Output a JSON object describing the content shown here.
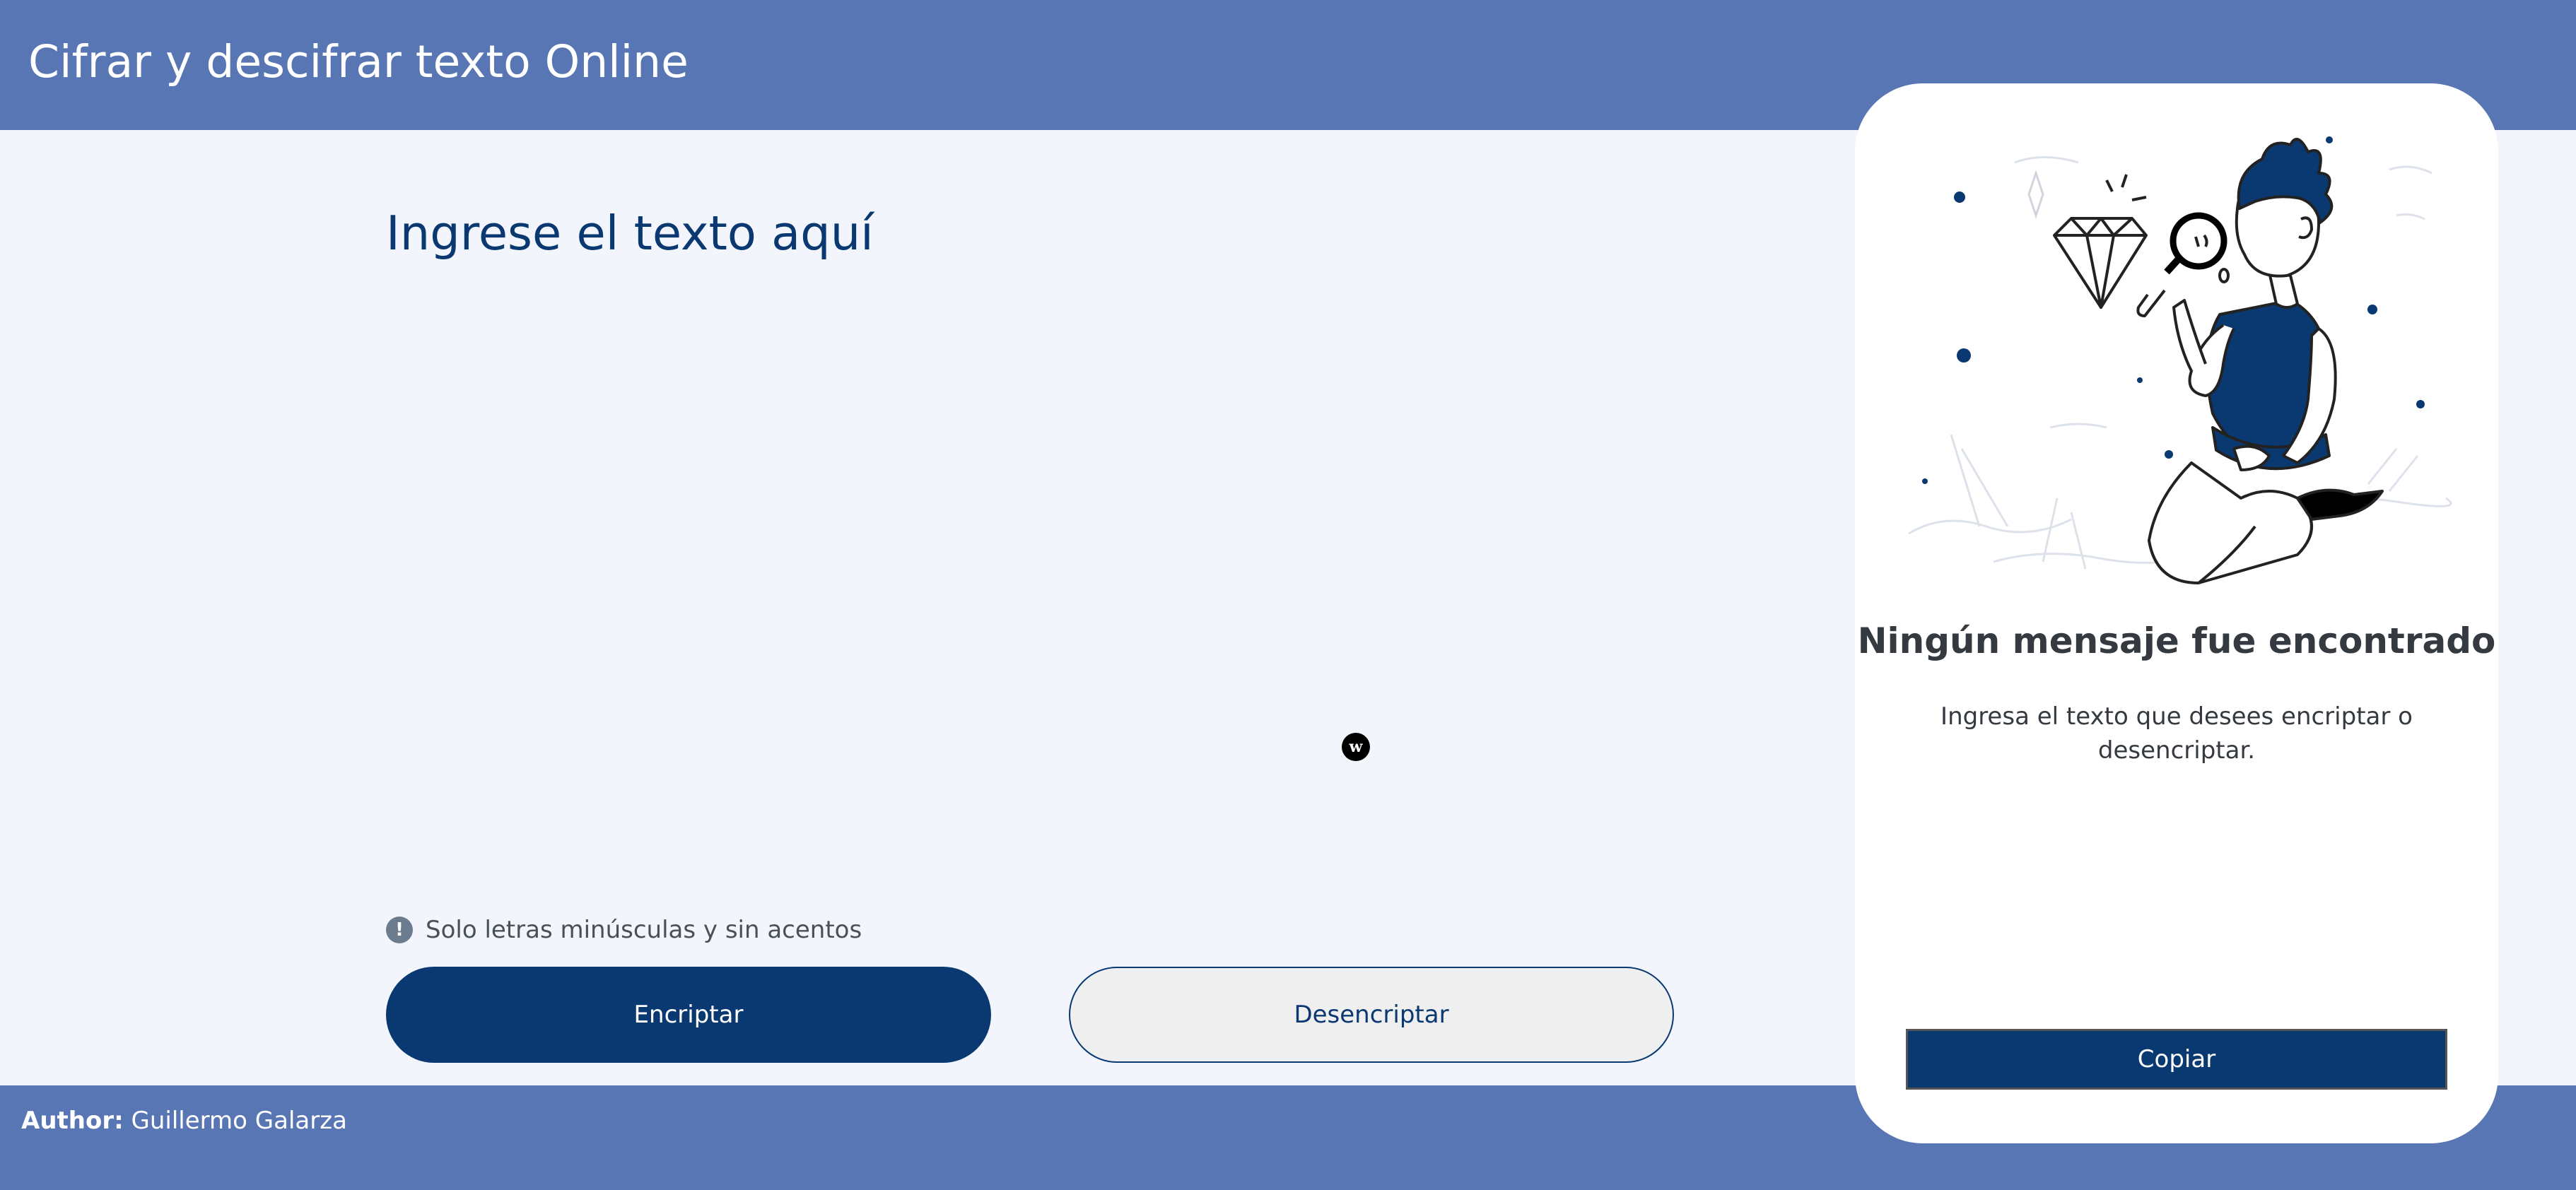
{
  "header": {
    "title": "Cifrar y descifrar texto Online"
  },
  "input": {
    "heading": "Ingrese el texto aquí",
    "value": "",
    "badge": "w",
    "hint_icon": "exclamation-icon",
    "hint": "Solo letras minúsculas y sin acentos"
  },
  "buttons": {
    "encrypt": "Encriptar",
    "decrypt": "Desencriptar",
    "copy": "Copiar"
  },
  "output": {
    "title": "Ningún mensaje fue encontrado",
    "description": "Ingresa el texto que desees encriptar o desencriptar.",
    "illustration": "person-with-magnifying-glass-illustration"
  },
  "footer": {
    "author_label": "Author:",
    "author_name": "Guillermo Galarza"
  },
  "colors": {
    "header_bg": "#5875b4",
    "page_bg": "#f2f5fc",
    "primary": "#0a3871",
    "card_bg": "#ffffff"
  }
}
